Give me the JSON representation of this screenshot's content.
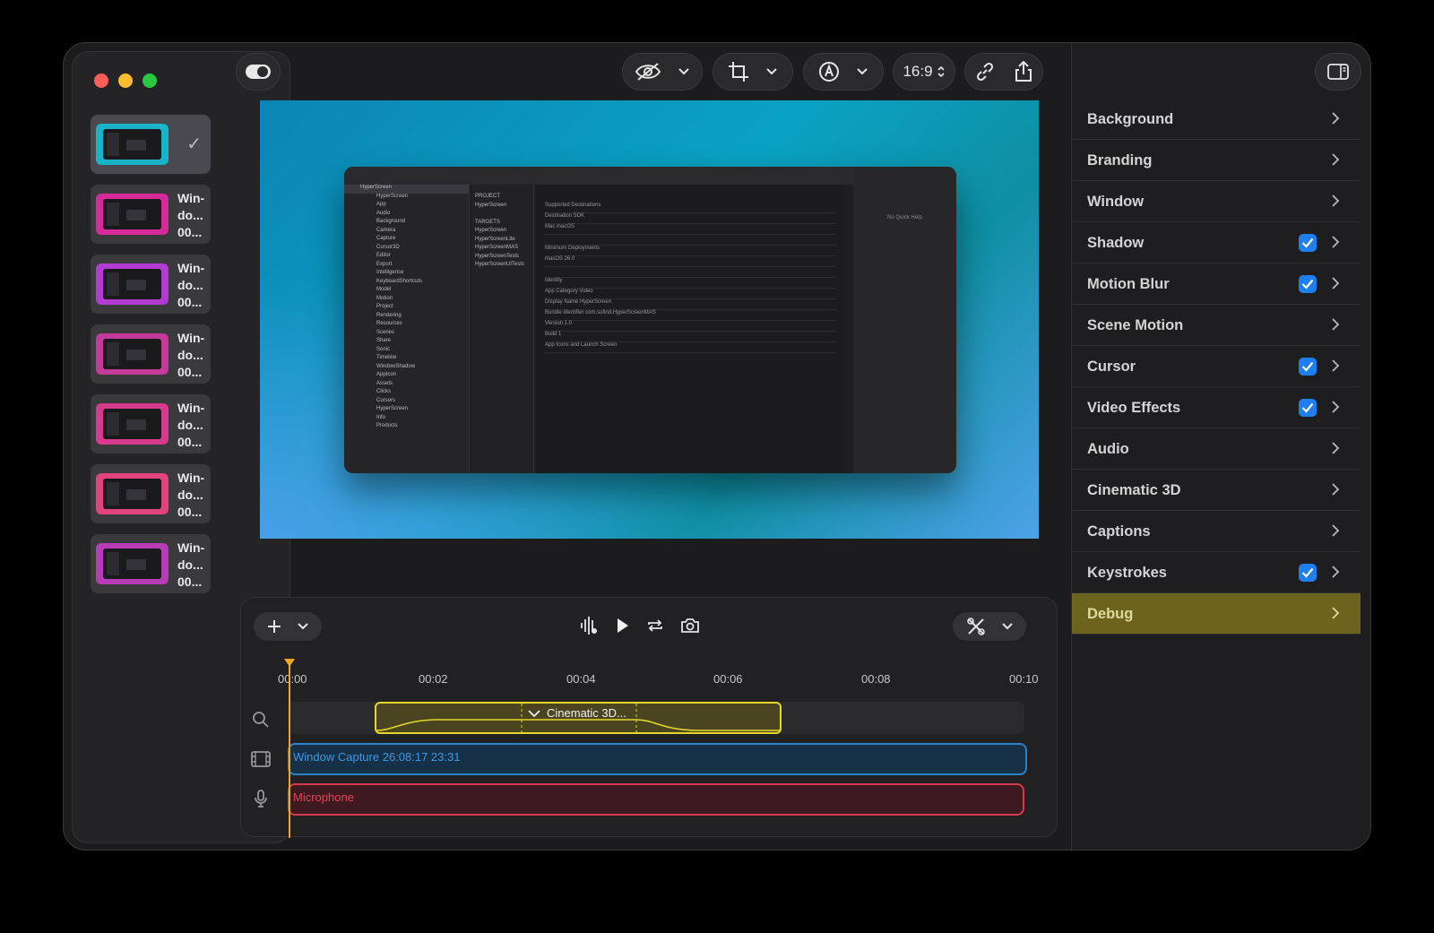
{
  "sidebar": {
    "recordings": [
      {
        "caption": "",
        "selected": true,
        "glow": "#19b3c9"
      },
      {
        "caption": "Win-\ndo...\n00...",
        "glow": "#d62a9a"
      },
      {
        "caption": "Win-\ndo...\n00...",
        "glow": "#b33bd4"
      },
      {
        "caption": "Win-\ndo...\n00...",
        "glow": "#c43a9a"
      },
      {
        "caption": "Win-\ndo...\n00...",
        "glow": "#d63a8c"
      },
      {
        "caption": "Win-\ndo...\n00...",
        "glow": "#e0447a"
      },
      {
        "caption": "Win-\ndo...\n00...",
        "glow": "#b83cb8"
      }
    ]
  },
  "toolbar": {
    "aspect_ratio": "16:9"
  },
  "preview": {
    "nav_items": [
      "HyperScreen",
      "HyperScreen",
      "App",
      "Audio",
      "Background",
      "Camera",
      "Capture",
      "Cursor3D",
      "Editor",
      "Export",
      "Intelligence",
      "KeyboardShortcuts",
      "Model",
      "Motion",
      "Project",
      "Rendering",
      "Resources",
      "Scenes",
      "Share",
      "Sonic",
      "Timeline",
      "WindowShadow",
      "AppIcon",
      "Assets",
      "Clicks",
      "Cursors",
      "HyperScreen",
      "Info",
      "Products"
    ],
    "targets": [
      "PROJECT",
      "HyperScreen",
      "",
      "TARGETS",
      "HyperScreen",
      "HyperScreenLite",
      "HyperScreenMAS",
      "HyperScreenTests",
      "HyperScreenUITests"
    ],
    "settings_rows": [
      "Supported Destinations",
      "Destination     SDK",
      "Mac     macOS",
      "",
      "Minimum Deployments",
      "macOS 26.0",
      "",
      "Identity",
      "App Category  Video",
      "Display Name  HyperScreen",
      "Bundle Identifier  com.sufind.HyperScreenMAS",
      "Version  1.0",
      "Build  1",
      "App Icons and Launch Screen"
    ],
    "quick_help": "No Quick Help"
  },
  "timeline": {
    "ruler": [
      "00:00",
      "00:02",
      "00:04",
      "00:06",
      "00:08",
      "00:10"
    ],
    "clips": {
      "cinematic": "Cinematic 3D...",
      "window_capture": "Window Capture 26:08:17 23:31",
      "microphone": "Microphone"
    }
  },
  "inspector": {
    "sections": [
      {
        "label": "Background",
        "checked": false
      },
      {
        "label": "Branding",
        "checked": false
      },
      {
        "label": "Window",
        "checked": false
      },
      {
        "label": "Shadow",
        "checked": true
      },
      {
        "label": "Motion Blur",
        "checked": true
      },
      {
        "label": "Scene Motion",
        "checked": false
      },
      {
        "label": "Cursor",
        "checked": true
      },
      {
        "label": "Video Effects",
        "checked": true
      },
      {
        "label": "Audio",
        "checked": false
      },
      {
        "label": "Cinematic 3D",
        "checked": false
      },
      {
        "label": "Captions",
        "checked": false
      },
      {
        "label": "Keystrokes",
        "checked": true
      },
      {
        "label": "Debug",
        "checked": false,
        "active": true
      }
    ]
  },
  "colors": {
    "accent_blue": "#1e7ff0",
    "playhead": "#f0a623",
    "cinematic_clip": "#e6d52a",
    "window_clip": "#2e82c9",
    "mic_clip": "#d23c4c",
    "debug_highlight": "#6b631e"
  }
}
